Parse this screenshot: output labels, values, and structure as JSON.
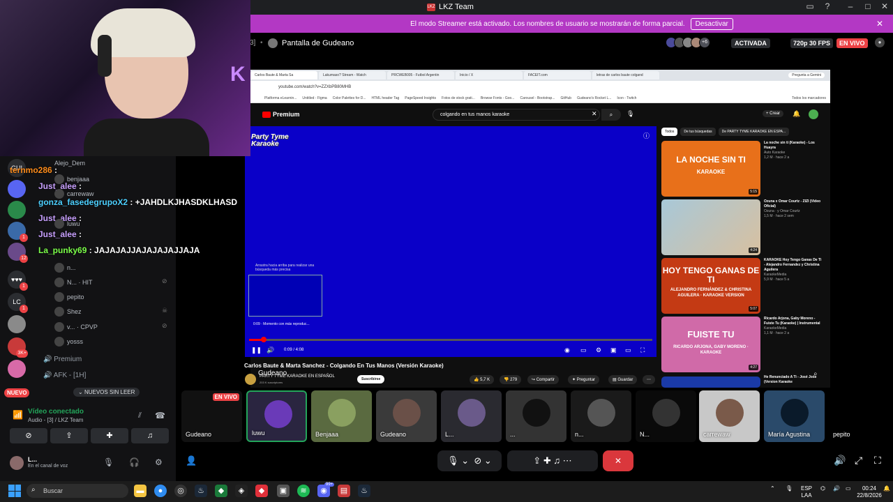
{
  "titlebar": {
    "title": "LKZ Team",
    "logo": "LKZ"
  },
  "banner": {
    "text": "El modo Streamer está activado. Los nombres de usuario se mostrarán de forma parcial.",
    "button": "Desactivar"
  },
  "stage": {
    "channel_prefix": "3]",
    "title": "Pantalla de Gudeano",
    "more_count": "+6",
    "activated": "ACTIVADA",
    "quality": "720p 30 FPS",
    "live": "EN VIVO"
  },
  "browser": {
    "tabs": [
      "Carlos Baute & Marta Sa",
      "Lakumaso? Stream - Watch",
      "PRCWEB005 - Futbol Argentin",
      "Inicio / X",
      "FACEIT.com",
      "letras de carlos baute colgand"
    ],
    "gemini": "Pregunta a Gemini",
    "url": "youtube.com/watch?v=ZZXbPB80MHB",
    "bookmarks": [
      "Platforma eLearnin...",
      "Untitled - Figma",
      "Color Palettes for D...",
      "HTML header Tag",
      "PageSpeed Insights",
      "Fotos de stock grati...",
      "Browse Fonts - Goo...",
      "Carousel - Bootstrap...",
      "GitHub",
      "Gudeano's Rocket L...",
      "Icon - Twitch",
      "Todos los marcadores"
    ]
  },
  "youtube": {
    "logo": "Premium",
    "search_value": "colgando en tus manos karaoke",
    "create": "+ Crear",
    "player_logo": "Party Tyme Karaoke",
    "scrub_tip": "Arrastra hacia arriba para realizar una búsqueda más precisa",
    "thumb_time": "0:09 · Momento con más reproduc...",
    "time": "0:09 / 4:08",
    "video_title": "Carlos Baute & Marta Sanchez - Colgando En Tus Manos (Versión Karaoke)",
    "channel": "PARTY TYME KARAOKE EN ESPAÑOL",
    "subscribers": "203 K suscriptores",
    "subscribe": "Suscribirse",
    "likes": "5,7 K",
    "dislikes": "279",
    "share": "Compartir",
    "ask": "Preguntar",
    "save": "Guardar",
    "chips": [
      "Todos",
      "De tus búsquedas",
      "De PARTY TYME KARAOKE EN ESPA..."
    ],
    "recs": [
      {
        "big": "LA NOCHE SIN TI",
        "sub": "KARAOKE",
        "dur": "5:15",
        "title": "La noche sin ti (Karaoke) - Los Huayra",
        "channel": "Auto Karaoke",
        "meta": "1,2 M · hace 2 a",
        "color": "#e8701a"
      },
      {
        "big": "",
        "sub": "",
        "dur": "4:24",
        "title": "Ozuna x Omar Courtz - ZIZI (Video Oficial)",
        "channel": "Ozuna · y Omar Courtz",
        "meta": "1,5 M · hace 2 sem",
        "color": "#a8c8d8"
      },
      {
        "big": "HOY TENGO GANAS DE TI",
        "sub": "ALEJANDRO FERNÁNDEZ & CHRISTINA AGUILERA · KARAOKE VERSION",
        "dur": "5:07",
        "title": "KARAOKE Hoy Tengo Ganas De Ti - Alejandro Fernandez y Christina Aguilera",
        "channel": "KaraokeMedia",
        "meta": "5,9 M · hace 5 a",
        "color": "#c43a14"
      },
      {
        "big": "FUISTE TU",
        "sub": "RICARDO ARJONA, GABY MORENO · KARAOKE",
        "dur": "4:27",
        "title": "Ricardo Arjona, Gaby Moreno - Fuiste Tu (Karaoke) | Instrumental",
        "channel": "KaraokeMedia",
        "meta": "1,1 M · hace 2 a",
        "color": "#d06aa8"
      },
      {
        "big": "",
        "sub": "",
        "dur": "",
        "title": "He Renunciado A Ti - José Jose (Version Karaoke",
        "channel": "",
        "meta": "",
        "color": "#1a3aa8"
      }
    ]
  },
  "presenter": "Gudeano",
  "chat": [
    {
      "user": "ternmo286",
      "msg": ":",
      "color": "#ff8c1a"
    },
    {
      "user": "Just_alee",
      "msg": ":",
      "color": "#c8a0ff"
    },
    {
      "user": "gonza_fasedegrupoX2",
      "msg": ": +JAHDLKJHASDKLHASD",
      "color": "#4dd0ff"
    },
    {
      "user": "Just_alee",
      "msg": ":",
      "color": "#c8a0ff"
    },
    {
      "user": "Just_alee",
      "msg": ":",
      "color": "#c8a0ff"
    },
    {
      "user": "La_punky69",
      "msg": ": JAJAJAJJAJAJAJAJJAJA",
      "color": "#7cff4a"
    }
  ],
  "voice_members": [
    "Alejo_Dem",
    "benjaaa",
    "carrewaw",
    "luwu",
    "n...",
    "N... · HIT",
    "pepito",
    "Shez",
    "v... · CPVP",
    "yosss"
  ],
  "categories": [
    "Premium",
    "AFK - [1H]"
  ],
  "servers": [
    "GUI",
    "",
    "",
    "c",
    "",
    "",
    "",
    "",
    "LC",
    "",
    "3K+",
    "",
    ""
  ],
  "nuevo": "NUEVO",
  "new_messages": "NUEVOS SIN LEER",
  "voice": {
    "status": "Vídeo conectado",
    "channel": "Audio - [3] / LKZ Team"
  },
  "user": {
    "name": "L...",
    "status": "En el canal de voz"
  },
  "tiles": [
    {
      "name": "Gudeano",
      "live": "EN VIVO"
    },
    {
      "name": "luwu"
    },
    {
      "name": "Benjaaa"
    },
    {
      "name": "Gudeano"
    },
    {
      "name": "L..."
    },
    {
      "name": "..."
    },
    {
      "name": "n..."
    },
    {
      "name": "N..."
    },
    {
      "name": "carrewaw"
    },
    {
      "name": "María Agustina"
    },
    {
      "name": "pepito"
    }
  ],
  "taskbar": {
    "search": "Buscar",
    "lang1": "ESP",
    "lang2": "LAA",
    "time": "00:24",
    "date": "22/8/2026",
    "badge": "99+"
  }
}
